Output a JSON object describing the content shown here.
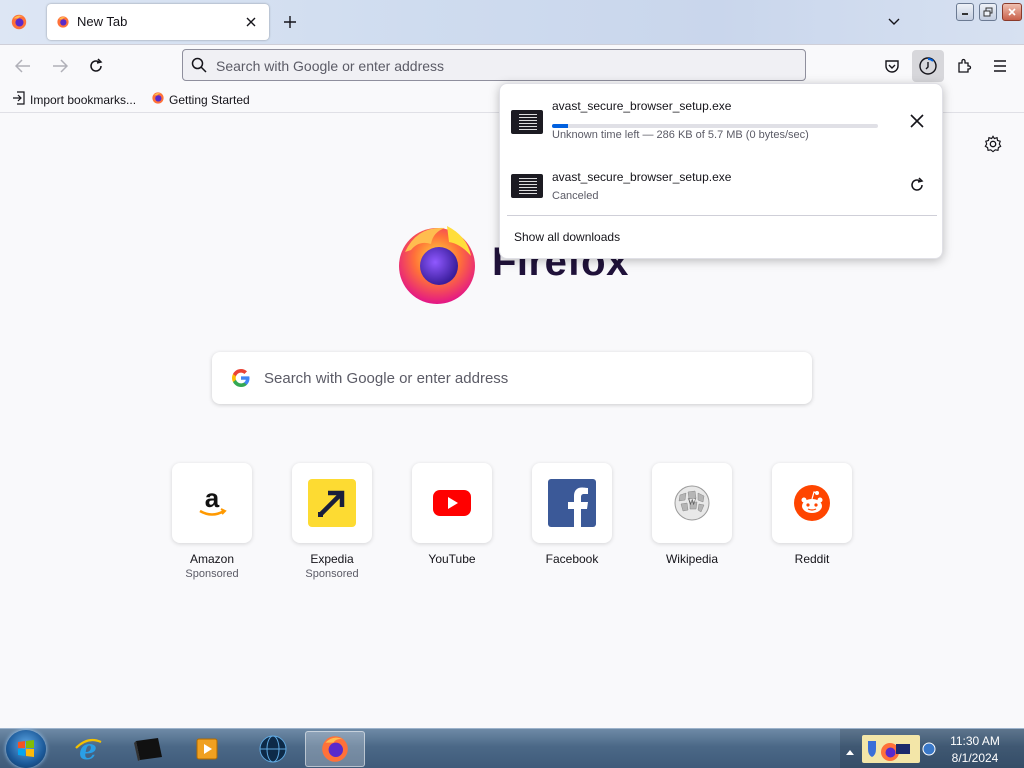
{
  "window": {
    "tabs": [
      {
        "label": "New Tab",
        "icon": "firefox-icon"
      }
    ]
  },
  "navbar": {
    "url_placeholder": "Search with Google or enter address"
  },
  "bookmarks": [
    {
      "label": "Import bookmarks...",
      "icon": "import-icon"
    },
    {
      "label": "Getting Started",
      "icon": "firefox-icon"
    }
  ],
  "newtab": {
    "logo_text": "Firefox",
    "search_placeholder": "Search with Google or enter address",
    "shortcuts": [
      {
        "title": "Amazon",
        "sponsor": "Sponsored",
        "icon": "amazon-icon"
      },
      {
        "title": "Expedia",
        "sponsor": "Sponsored",
        "icon": "expedia-icon"
      },
      {
        "title": "YouTube",
        "sponsor": "",
        "icon": "youtube-icon"
      },
      {
        "title": "Facebook",
        "sponsor": "",
        "icon": "facebook-icon"
      },
      {
        "title": "Wikipedia",
        "sponsor": "",
        "icon": "wikipedia-icon"
      },
      {
        "title": "Reddit",
        "sponsor": "",
        "icon": "reddit-icon"
      }
    ]
  },
  "downloads": {
    "items": [
      {
        "name": "avast_secure_browser_setup.exe",
        "status": "Unknown time left — 286 KB of 5.7 MB (0 bytes/sec)",
        "progress": 0.05,
        "action": "cancel"
      },
      {
        "name": "avast_secure_browser_setup.exe",
        "status": "Canceled",
        "action": "retry"
      }
    ],
    "show_all": "Show all downloads"
  },
  "taskbar": {
    "time": "11:30 AM",
    "date": "8/1/2024"
  },
  "colors": {
    "accent": "#0060df",
    "firefox_orange": "#ff7139",
    "firefox_purple": "#592acb"
  }
}
